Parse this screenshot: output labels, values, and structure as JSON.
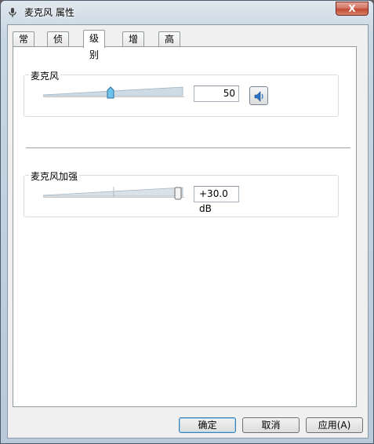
{
  "window": {
    "title": "麦克风 属性",
    "close_glyph": "X"
  },
  "tabs": [
    {
      "label": "常规",
      "active": false
    },
    {
      "label": "侦听",
      "active": false
    },
    {
      "label": "级别",
      "active": true
    },
    {
      "label": "增强",
      "active": false
    },
    {
      "label": "高级",
      "active": false
    }
  ],
  "microphone": {
    "label": "麦克风",
    "value": "50",
    "level_fraction": 0.5
  },
  "boost": {
    "label": "麦克风加强",
    "value": "+30.0 dB",
    "level_fraction": 1.0
  },
  "buttons": {
    "ok": "确定",
    "cancel": "取消",
    "apply": "应用(A)"
  },
  "colors": {
    "accent": "#3c7fb1",
    "close": "#c14a33"
  }
}
